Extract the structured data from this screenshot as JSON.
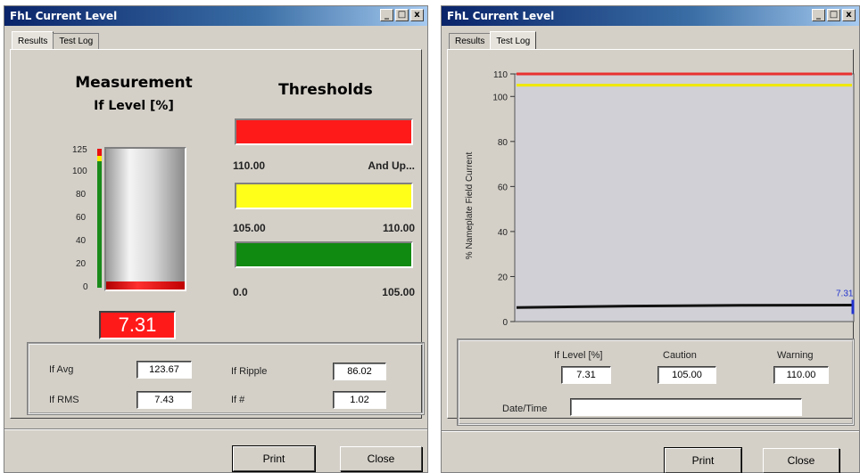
{
  "left_window": {
    "title": "FhL Current Level",
    "tabs": [
      "Results",
      "Test Log"
    ],
    "active_tab": "Results",
    "measurement": {
      "title": "Measurement",
      "subtitle": "If Level [%]",
      "scale": [
        "125",
        "100",
        "80",
        "60",
        "40",
        "20",
        "0"
      ],
      "level_fraction": 0.058,
      "value_display": "7.31",
      "bar_color": "#e81010"
    },
    "thresholds": {
      "title": "Thresholds",
      "items": [
        {
          "color": "#ff1a1a",
          "low": "110.00",
          "high": "And Up..."
        },
        {
          "color": "#ffff1a",
          "low": "105.00",
          "high": "110.00"
        },
        {
          "color": "#108a10",
          "low": "0.0",
          "high": "105.00"
        }
      ]
    },
    "stats": {
      "avg_label": "If Avg",
      "avg_value": "123.67",
      "ripple_label": "If Ripple",
      "ripple_value": "86.02",
      "rms_label": "If RMS",
      "rms_value": "7.43",
      "ff_label": "If #",
      "ff_value": "1.02"
    },
    "buttons": {
      "print": "Print",
      "close": "Close"
    }
  },
  "right_window": {
    "title": "FhL Current Level",
    "tabs": [
      "Results",
      "Test Log"
    ],
    "active_tab": "Test Log",
    "chart_data": {
      "type": "line",
      "ylabel": "% Nameplate Field Current",
      "yticks": [
        "110",
        "100",
        "80",
        "60",
        "40",
        "20",
        "0"
      ],
      "ylim": [
        0,
        110
      ],
      "series": [
        {
          "values": [
            110,
            110
          ],
          "color": "#e83030"
        },
        {
          "values": [
            105,
            105
          ],
          "color": "#f0e800"
        },
        {
          "values": [
            6.2,
            6.9,
            7.2,
            7.31
          ],
          "color": "#111111"
        }
      ],
      "end_label": "7.31",
      "end_label_color": "#2233cc",
      "grid": false
    },
    "fields": {
      "level_label": "If Level [%]",
      "level_value": "7.31",
      "caution_label": "Caution",
      "caution_value": "105.00",
      "warning_label": "Warning",
      "warning_value": "110.00",
      "datetime_label": "Date/Time",
      "datetime_value": ""
    },
    "buttons": {
      "print": "Print",
      "close": "Close"
    }
  }
}
